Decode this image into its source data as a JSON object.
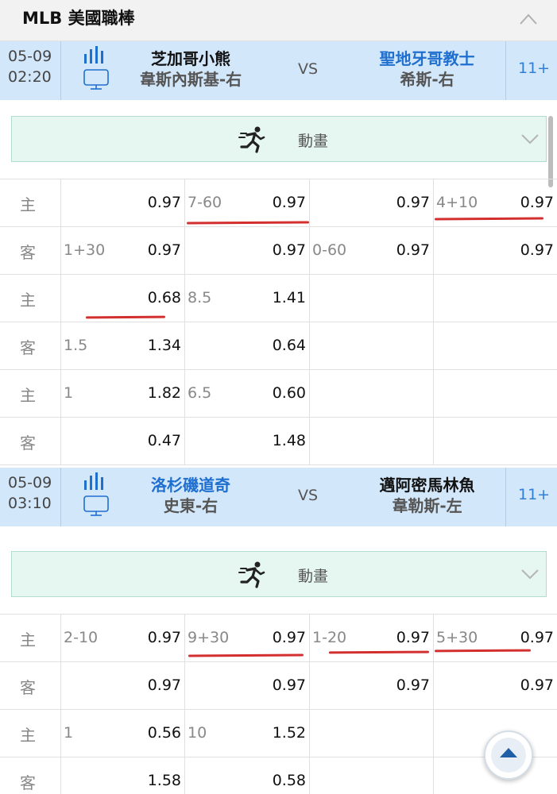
{
  "header": {
    "title": "MLB 美國職棒"
  },
  "matches": [
    {
      "date": "05-09",
      "time": "02:20",
      "home_team": "芝加哥小熊",
      "home_pitcher": "韋斯內斯基-右",
      "vs": "VS",
      "away_team": "聖地牙哥教士",
      "away_pitcher": "希斯-右",
      "more": "11+",
      "animation_label": "動畫",
      "rows": [
        {
          "side": "主",
          "l1": "",
          "o1": "0.97",
          "l2": "7-60",
          "o2": "0.97",
          "l3": "",
          "o3": "0.97",
          "l4": "4+10",
          "o4": "0.97"
        },
        {
          "side": "客",
          "l1": "1+30",
          "o1": "0.97",
          "l2": "",
          "o2": "0.97",
          "l3": "0-60",
          "o3": "0.97",
          "l4": "",
          "o4": "0.97"
        },
        {
          "side": "主",
          "l1": "",
          "o1": "0.68",
          "l2": "8.5",
          "o2": "1.41",
          "l3": "",
          "o3": "",
          "l4": "",
          "o4": ""
        },
        {
          "side": "客",
          "l1": "1.5",
          "o1": "1.34",
          "l2": "",
          "o2": "0.64",
          "l3": "",
          "o3": "",
          "l4": "",
          "o4": ""
        },
        {
          "side": "主",
          "l1": "1",
          "o1": "1.82",
          "l2": "6.5",
          "o2": "0.60",
          "l3": "",
          "o3": "",
          "l4": "",
          "o4": ""
        },
        {
          "side": "客",
          "l1": "",
          "o1": "0.47",
          "l2": "",
          "o2": "1.48",
          "l3": "",
          "o3": "",
          "l4": "",
          "o4": ""
        }
      ]
    },
    {
      "date": "05-09",
      "time": "03:10",
      "home_team": "洛杉磯道奇",
      "home_pitcher": "史東-右",
      "vs": "VS",
      "away_team": "邁阿密馬林魚",
      "away_pitcher": "韋勒斯-左",
      "more": "11+",
      "animation_label": "動畫",
      "rows": [
        {
          "side": "主",
          "l1": "2-10",
          "o1": "0.97",
          "l2": "9+30",
          "o2": "0.97",
          "l3": "1-20",
          "o3": "0.97",
          "l4": "5+30",
          "o4": "0.97"
        },
        {
          "side": "客",
          "l1": "",
          "o1": "0.97",
          "l2": "",
          "o2": "0.97",
          "l3": "",
          "o3": "0.97",
          "l4": "",
          "o4": "0.97"
        },
        {
          "side": "主",
          "l1": "1",
          "o1": "0.56",
          "l2": "10",
          "o2": "1.52",
          "l3": "",
          "o3": "",
          "l4": "",
          "o4": ""
        },
        {
          "side": "客",
          "l1": "",
          "o1": "1.58",
          "l2": "",
          "o2": "0.58",
          "l3": "",
          "o3": "",
          "l4": "",
          "o4": ""
        }
      ]
    }
  ],
  "colors": {
    "home_link": "#1f6fcf",
    "header_bg": "#f2f2f2",
    "match_bg": "#d3e7fa",
    "animation_bg": "#e6f6f1",
    "underline": "#d32f2f"
  },
  "icons": [
    "chevron-up-icon",
    "stats-bars-icon",
    "tv-icon",
    "runner-icon",
    "chevron-down-icon",
    "back-to-top-icon"
  ]
}
